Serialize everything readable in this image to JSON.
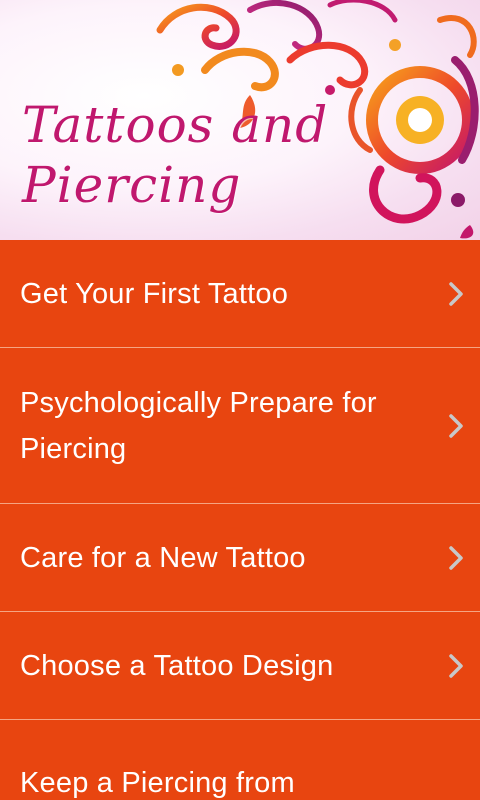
{
  "header": {
    "title_line1": "Tattoos and",
    "title_line2": "Piercing"
  },
  "menu": {
    "items": [
      {
        "label": "Get Your First Tattoo"
      },
      {
        "label": "Psychologically Prepare for Piercing"
      },
      {
        "label": "Care for a New Tattoo"
      },
      {
        "label": "Choose a Tattoo Design"
      },
      {
        "label": "Keep a Piercing from"
      }
    ]
  },
  "icons": {
    "chevron": "chevron-right-icon"
  },
  "colors": {
    "menu_background": "#e84510",
    "divider": "#f5a583",
    "title_text": "#c0186e",
    "menu_text": "#ffffff",
    "chevron": "#c8c8c8"
  }
}
